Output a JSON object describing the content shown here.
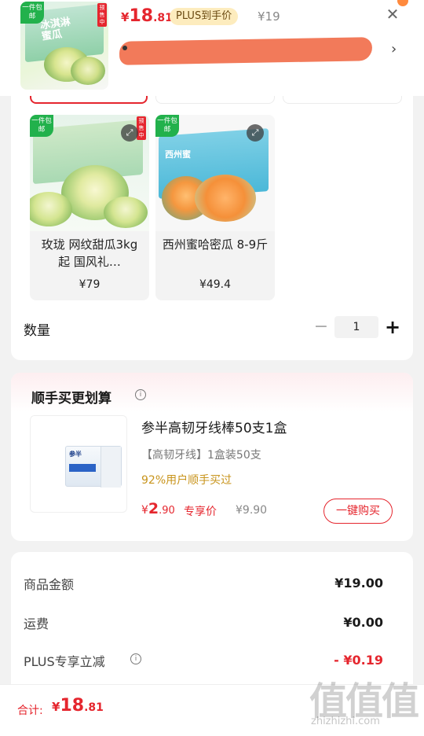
{
  "header": {
    "price_currency": "¥",
    "price_int": "18",
    "price_dec": ".81",
    "plus_badge": "PLUS到手价",
    "original_price": "¥19",
    "close_icon": "close-icon",
    "chevron_icon": "chevron-right-icon",
    "thumb_box_text": "冰淇淋蜜瓜",
    "thumb_tag": "一件包邮",
    "thumb_red_tag": "预售中"
  },
  "variants": [
    {
      "name": "玫珑 网纹甜瓜3kg起 国风礼…",
      "price": "¥79",
      "tag_green": "一件包邮",
      "tag_red": "预售中"
    },
    {
      "name": "西州蜜哈密瓜 8-9斤",
      "price": "¥49.4",
      "tag_green": "一件包邮",
      "box_text": "西州蜜"
    }
  ],
  "quantity": {
    "label": "数量",
    "value": "1",
    "minus": "−",
    "plus": "+"
  },
  "addon": {
    "title": "顺手买更划算",
    "info_icon": "info-icon",
    "product_name": "参半高韧牙线棒50支1盒",
    "description": "【高韧牙线】1盒装50支",
    "social_proof": "92%用户顺手买过",
    "price_currency": "¥",
    "price_int": "2",
    "price_dec": ".90",
    "price_tag": "专享价",
    "original_price": "¥9.90",
    "buy_button": "一键购买",
    "box_brand": "参半"
  },
  "costs": [
    {
      "label": "商品金额",
      "value": "¥19.00"
    },
    {
      "label": "运费",
      "value": "¥0.00"
    },
    {
      "label": "PLUS专享立减",
      "value": "- ¥0.19"
    }
  ],
  "footer": {
    "total_label": "合计:",
    "total_currency": "¥",
    "total_int": "18",
    "total_dec": ".81"
  },
  "watermark": {
    "big": "值值值",
    "small": "zhizhizhi.com"
  },
  "colors": {
    "accent_red": "#e5262e",
    "plus_gold": "#fdecbe",
    "social_gold": "#c8941c",
    "tag_green": "#22b14c"
  }
}
